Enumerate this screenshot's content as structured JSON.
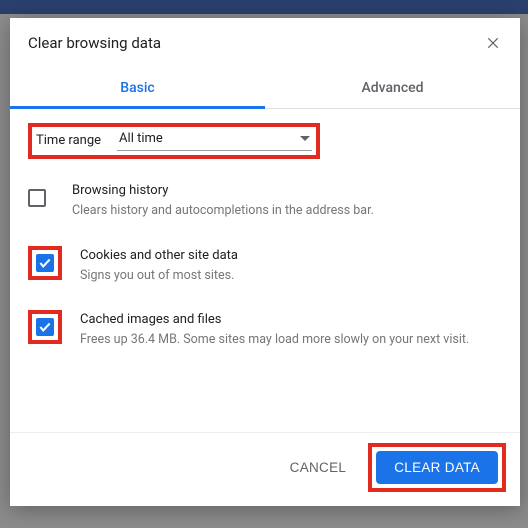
{
  "dialog": {
    "title": "Clear browsing data"
  },
  "tabs": {
    "basic": "Basic",
    "advanced": "Advanced"
  },
  "time_range": {
    "label": "Time range",
    "value": "All time"
  },
  "options": {
    "history": {
      "title": "Browsing history",
      "desc": "Clears history and autocompletions in the address bar.",
      "checked": false
    },
    "cookies": {
      "title": "Cookies and other site data",
      "desc": "Signs you out of most sites.",
      "checked": true
    },
    "cache": {
      "title": "Cached images and files",
      "desc": "Frees up 36.4 MB. Some sites may load more slowly on your next visit.",
      "checked": true
    }
  },
  "footer": {
    "cancel": "CANCEL",
    "clear": "CLEAR DATA"
  }
}
